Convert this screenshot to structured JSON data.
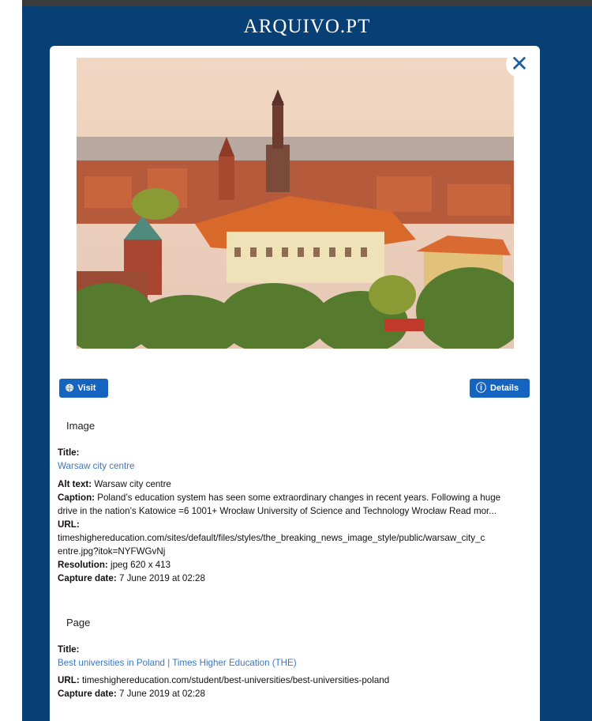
{
  "brand": "ARQUIVO.PT",
  "close_label": "✕",
  "buttons": {
    "visit": "Visit",
    "details": "Details"
  },
  "image": {
    "section_label": "Image",
    "title_label": "Title:",
    "title": "Warsaw city centre",
    "alt_label": "Alt text:",
    "alt": "Warsaw city centre",
    "caption_label": "Caption:",
    "caption_line1": "Poland’s education system has seen some extraordinary changes in recent years. Following a huge",
    "caption_line2": "drive in the nation’s Katowice =6 1001+ Wrocław University of Science and Technology Wrocław Read mor...",
    "url_label": "URL:",
    "url_line1": "timeshighereducation.com/sites/default/files/styles/the_breaking_news_image_style/public/warsaw_city_c",
    "url_line2": "entre.jpg?itok=NYFWGvNj",
    "resolution_label": "Resolution:",
    "resolution": "jpeg 620 x 413",
    "capture_label": "Capture date:",
    "capture": "7 June 2019 at 02:28"
  },
  "page": {
    "section_label": "Page",
    "title_label": "Title:",
    "title": "Best universities in Poland | Times Higher Education (THE)",
    "url_label": "URL:",
    "url": "timeshighereducation.com/student/best-universities/best-universities-poland",
    "capture_label": "Capture date:",
    "capture": "7 June 2019 at 02:28"
  }
}
